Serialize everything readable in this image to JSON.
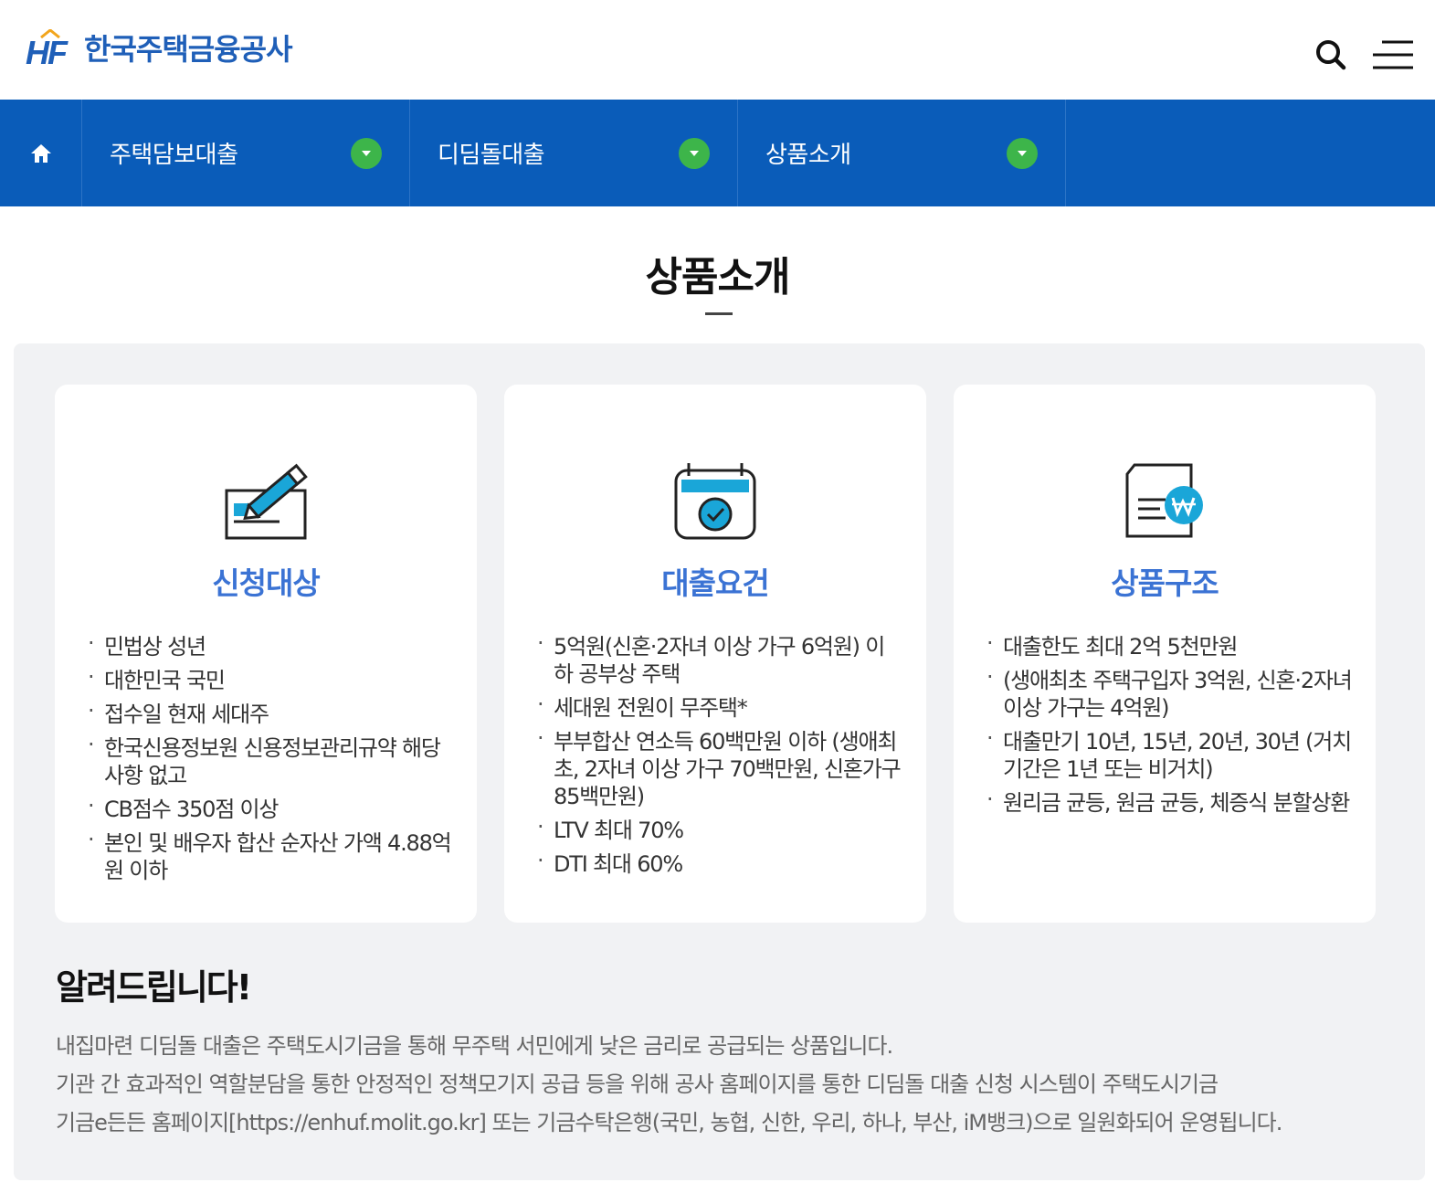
{
  "header": {
    "logo_mark": "HF",
    "logo_name": "한국주택금융공사"
  },
  "nav": {
    "items": [
      {
        "label": "주택담보대출"
      },
      {
        "label": "디딤돌대출"
      },
      {
        "label": "상품소개"
      }
    ]
  },
  "page": {
    "title": "상품소개"
  },
  "cards": [
    {
      "title": "신청대상",
      "icon": "pen-on-paper-icon",
      "items": [
        "민법상 성년",
        "대한민국 국민",
        "접수일 현재 세대주",
        "한국신용정보원 신용정보관리규약 해당사항 없고",
        "CB점수 350점 이상",
        "본인 및 배우자 합산 순자산 가액 4.88억원 이하"
      ]
    },
    {
      "title": "대출요건",
      "icon": "calendar-check-icon",
      "items": [
        "5억원(신혼·2자녀 이상 가구 6억원) 이하 공부상 주택",
        "세대원 전원이 무주택*",
        "부부합산 연소득 60백만원 이하 (생애최초, 2자녀 이상 가구 70백만원, 신혼가구 85백만원)",
        "LTV 최대 70%",
        "DTI 최대 60%"
      ]
    },
    {
      "title": "상품구조",
      "icon": "document-won-icon",
      "items": [
        "대출한도 최대 2억 5천만원",
        "(생애최초 주택구입자 3억원, 신혼·2자녀 이상 가구는 4억원)",
        "대출만기 10년, 15년, 20년, 30년 (거치기간은 1년 또는 비거치)",
        "원리금 균등, 원금 균등, 체증식 분할상환"
      ]
    }
  ],
  "notice": {
    "title": "알려드립니다!",
    "lines": [
      "내집마련 디딤돌 대출은 주택도시기금을 통해 무주택 서민에게 낮은 금리로 공급되는 상품입니다.",
      "기관 간 효과적인 역할분담을 통한 안정적인 정책모기지 공급 등을 위해 공사 홈페이지를 통한 디딤돌 대출 신청 시스템이 주택도시기금",
      "기금e든든 홈페이지[https://enhuf.molit.go.kr] 또는 기금수탁은행(국민, 농협, 신한, 우리, 하나, 부산, iM뱅크)으로 일원화되어 운영됩니다."
    ]
  },
  "colors": {
    "brand_blue": "#1f5fb8",
    "nav_blue": "#0a5cb9",
    "accent_green": "#3db54a",
    "card_title_blue": "#3b73d4",
    "panel_grey": "#f1f2f4"
  }
}
